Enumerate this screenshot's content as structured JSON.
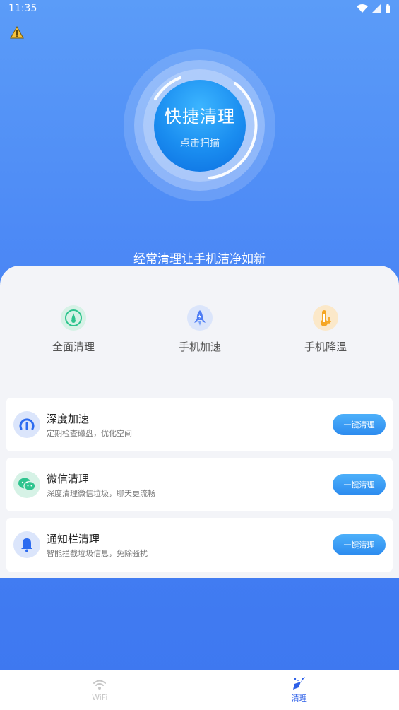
{
  "status_bar": {
    "time": "11:35"
  },
  "scan": {
    "title": "快捷清理",
    "subtitle": "点击扫描"
  },
  "tagline": "经常清理让手机洁净如新",
  "quick_actions": [
    {
      "label": "全面清理",
      "icon": "broom-circle-icon",
      "color": "#2ec48e"
    },
    {
      "label": "手机加速",
      "icon": "rocket-icon",
      "color": "#4d7cf5"
    },
    {
      "label": "手机降温",
      "icon": "thermometer-icon",
      "color": "#f5a623"
    }
  ],
  "list": [
    {
      "title": "深度加速",
      "subtitle": "定期检查磁盘，优化空间",
      "button": "一键清理",
      "icon": "speedometer-icon"
    },
    {
      "title": "微信清理",
      "subtitle": "深度清理微信垃圾，聊天更流畅",
      "button": "一键清理",
      "icon": "wechat-icon"
    },
    {
      "title": "通知栏清理",
      "subtitle": "智能拦截垃圾信息，免除骚扰",
      "button": "一键清理",
      "icon": "bell-icon"
    }
  ],
  "nav": [
    {
      "label": "WiFi",
      "icon": "wifi-icon",
      "active": false
    },
    {
      "label": "清理",
      "icon": "broom-icon",
      "active": true
    }
  ],
  "colors": {
    "accent": "#2c5fe8",
    "background_top": "#5b9cf8",
    "background_bottom": "#3d77f0"
  }
}
